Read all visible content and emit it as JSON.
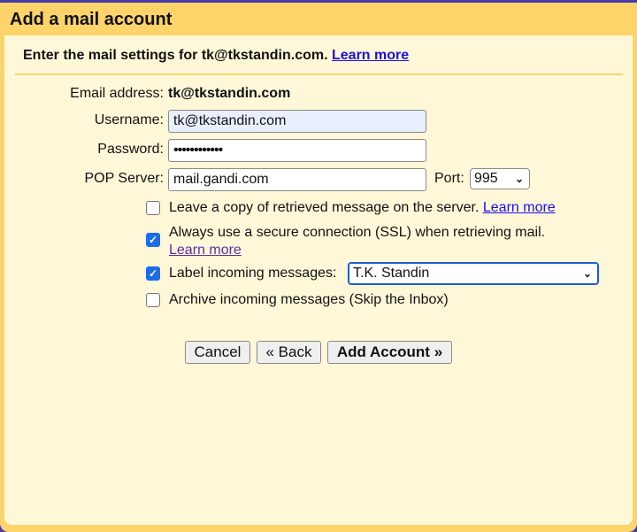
{
  "dialog": {
    "title": "Add a mail account"
  },
  "intro": {
    "text": "Enter the mail settings for tk@tkstandin.com.",
    "learn_more": "Learn more"
  },
  "form": {
    "email_label": "Email address:",
    "email_value": "tk@tkstandin.com",
    "username_label": "Username:",
    "username_value": "tk@tkstandin.com",
    "password_label": "Password:",
    "password_value": "••••••••••••",
    "pop_label": "POP Server:",
    "pop_value": "mail.gandi.com",
    "port_label": "Port:",
    "port_value": "995"
  },
  "options": [
    {
      "label": "Leave a copy of retrieved message on the server.",
      "link": "Learn more",
      "checked": false
    },
    {
      "label": "Always use a secure connection (SSL) when retrieving mail.",
      "link": "Learn more",
      "checked": true
    },
    {
      "label": "Label incoming messages:",
      "select_value": "T.K. Standin",
      "checked": true
    },
    {
      "label": "Archive incoming messages (Skip the Inbox)",
      "checked": false
    }
  ],
  "buttons": {
    "cancel": "Cancel",
    "back": "« Back",
    "add": "Add Account »"
  },
  "colors": {
    "header": "#fcd46a",
    "panel": "#fff8d8",
    "link": "#1a0dee",
    "checkbox": "#1a6ee8"
  }
}
